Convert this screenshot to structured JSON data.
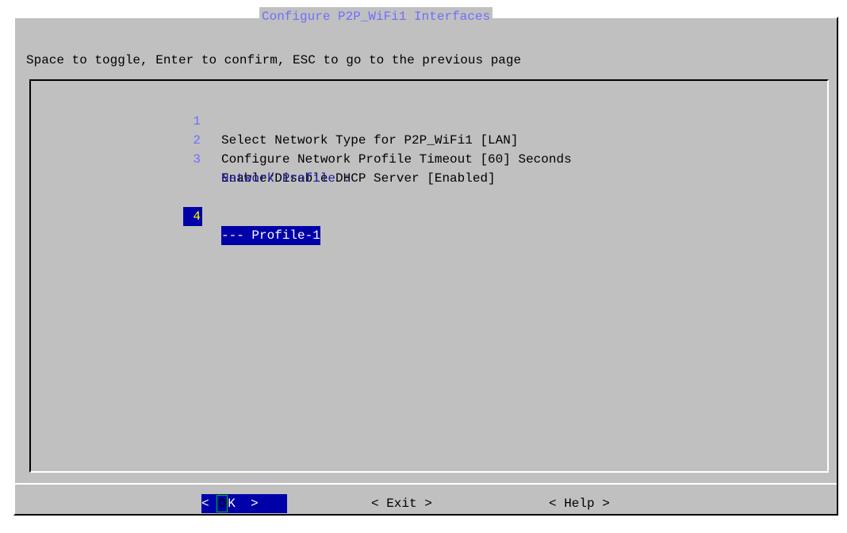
{
  "dialog": {
    "title": "Configure P2P_WiFi1 Interfaces",
    "instruction": "Space to toggle, Enter to confirm, ESC to go to the previous page"
  },
  "menu": {
    "items": [
      {
        "number": "1",
        "label": "Select Network Type for P2P_WiFi1 [LAN]"
      },
      {
        "number": "2",
        "label": "Configure Network Profile Timeout [60] Seconds"
      },
      {
        "number": "3",
        "label": "Enable/Disable DHCP Server [Enabled]"
      }
    ],
    "section_header": "Network Profile :",
    "selected_item": {
      "number": "4",
      "label": "--- Profile-1"
    }
  },
  "buttons": {
    "ok_left": "< ",
    "ok_hotkey": "O",
    "ok_rest": "K  >",
    "exit": "< Exit >",
    "help": "< Help >"
  },
  "colors": {
    "dialog_background": "#c0c0c0",
    "title_text": "#6e6eff",
    "selection_background": "#0000a8",
    "selection_number": "#ffff00",
    "hotkey_outline": "#00c000"
  }
}
